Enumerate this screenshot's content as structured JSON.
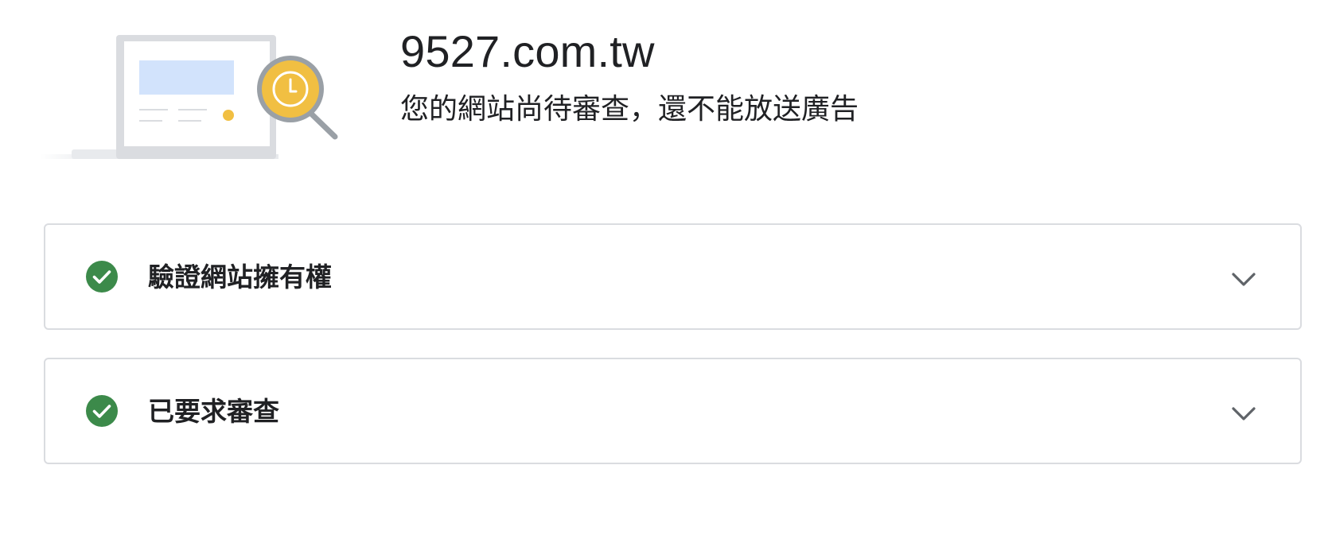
{
  "header": {
    "site_title": "9527.com.tw",
    "status_message": "您的網站尚待審查，還不能放送廣告",
    "illustration": "website-under-review-illustration"
  },
  "steps": [
    {
      "label": "驗證網站擁有權",
      "status": "completed",
      "status_icon": "check-circle-icon",
      "expand_icon": "chevron-down-icon"
    },
    {
      "label": "已要求審查",
      "status": "completed",
      "status_icon": "check-circle-icon",
      "expand_icon": "chevron-down-icon"
    }
  ],
  "colors": {
    "success_green": "#3c8a4a",
    "review_yellow": "#f1bf42",
    "panel_border": "#dadce0",
    "text_primary": "#202124",
    "chevron": "#5f6368"
  }
}
